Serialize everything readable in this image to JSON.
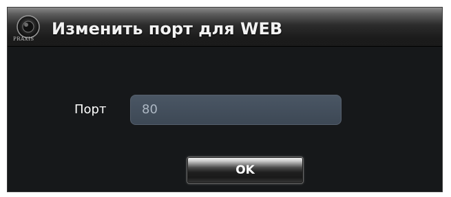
{
  "dialog": {
    "title": "Изменить порт для WEB",
    "logo_text": "PRAXIS",
    "port_label": "Порт",
    "port_value": "80",
    "ok_label": "OK"
  }
}
